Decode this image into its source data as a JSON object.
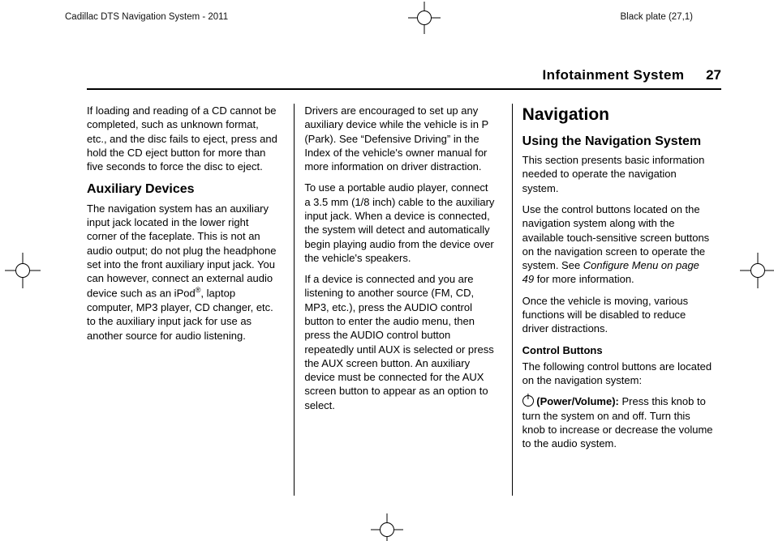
{
  "crop": {
    "doc_left": "Cadillac DTS Navigation System - 2011",
    "doc_right": "Black plate (27,1)"
  },
  "running_head": {
    "chapter": "Infotainment System",
    "page_number": "27"
  },
  "col1": {
    "p1": "If loading and reading of a CD cannot be completed, such as unknown format, etc., and the disc fails to eject, press and hold the CD eject button for more than five seconds to force the disc to eject.",
    "h2": "Auxiliary Devices",
    "p2a": "The navigation system has an auxiliary input jack located in the lower right corner of the faceplate. This is not an audio output; do not plug the headphone set into the front auxiliary input jack. You can however, connect an external audio device such as an iPod",
    "p2b": ", laptop computer, MP3 player, CD changer, etc. to the auxiliary input jack for use as another source for audio listening."
  },
  "col2": {
    "p1": "Drivers are encouraged to set up any auxiliary device while the vehicle is in P (Park). See “Defensive Driving” in the Index of the vehicle's owner manual for more information on driver distraction.",
    "p2": "To use a portable audio player, connect a 3.5 mm (1/8 inch) cable to the auxiliary input jack. When a device is connected, the system will detect and automatically begin playing audio from the device over the vehicle's speakers.",
    "p3": "If a device is connected and you are listening to another source (FM, CD, MP3, etc.), press the AUDIO control button to enter the audio menu, then press the AUDIO control button repeatedly until AUX is selected or press the AUX screen button. An auxiliary device must be connected for the AUX screen button to appear as an option to select."
  },
  "col3": {
    "h1": "Navigation",
    "h2": "Using the Navigation System",
    "p1": "This section presents basic information needed to operate the navigation system.",
    "p2a": "Use the control buttons located on the navigation system along with the available touch-sensitive screen buttons on the navigation screen to operate the system. See ",
    "p2_link": "Configure Menu on page 49",
    "p2b": " for more information.",
    "p3": "Once the vehicle is moving, various functions will be disabled to reduce driver distractions.",
    "h3": "Control Buttons",
    "p4": "The following control buttons are located on the navigation system:",
    "p5_label": " (Power/Volume): ",
    "p5_text": " Press this knob to turn the system on and off. Turn this knob to increase or decrease the volume to the audio system."
  }
}
